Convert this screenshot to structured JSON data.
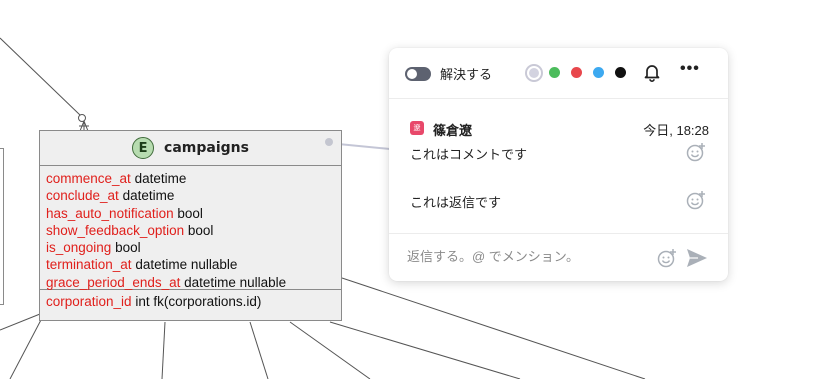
{
  "entity": {
    "badge": "E",
    "name": "campaigns",
    "fields": [
      {
        "name": "commence_at",
        "type": "datetime"
      },
      {
        "name": "conclude_at",
        "type": "datetime"
      },
      {
        "name": "has_auto_notification",
        "type": "bool"
      },
      {
        "name": "show_feedback_option",
        "type": "bool"
      },
      {
        "name": "is_ongoing",
        "type": "bool"
      },
      {
        "name": "termination_at",
        "type": "datetime nullable"
      },
      {
        "name": "grace_period_ends_at",
        "type": "datetime nullable"
      }
    ],
    "foreign_key": {
      "name": "corporation_id",
      "type": "int fk(corporations.id)"
    }
  },
  "comment_panel": {
    "resolve_label": "解決する",
    "resolved": false,
    "colors": [
      {
        "name": "gray",
        "hex": "#d3d3e0",
        "selected": true
      },
      {
        "name": "green",
        "hex": "#4cbc5c"
      },
      {
        "name": "red",
        "hex": "#e8474c"
      },
      {
        "name": "blue",
        "hex": "#3da9f0"
      },
      {
        "name": "black",
        "hex": "#111111"
      }
    ],
    "icons": {
      "notify": "bell-icon",
      "more": "more-icon",
      "reaction": "emoji-add-icon",
      "send": "send-icon"
    },
    "more_label": "•••",
    "comment": {
      "avatar_text": "遼",
      "author": "篠倉遼",
      "timestamp": "今日, 18:28",
      "text": "これはコメントです"
    },
    "reply": {
      "text": "これは返信です"
    },
    "input": {
      "placeholder": "返信する。@ でメンション。",
      "value": ""
    }
  },
  "colors": {
    "field_name": "#e0201c",
    "accent": "#8fa7ff"
  }
}
